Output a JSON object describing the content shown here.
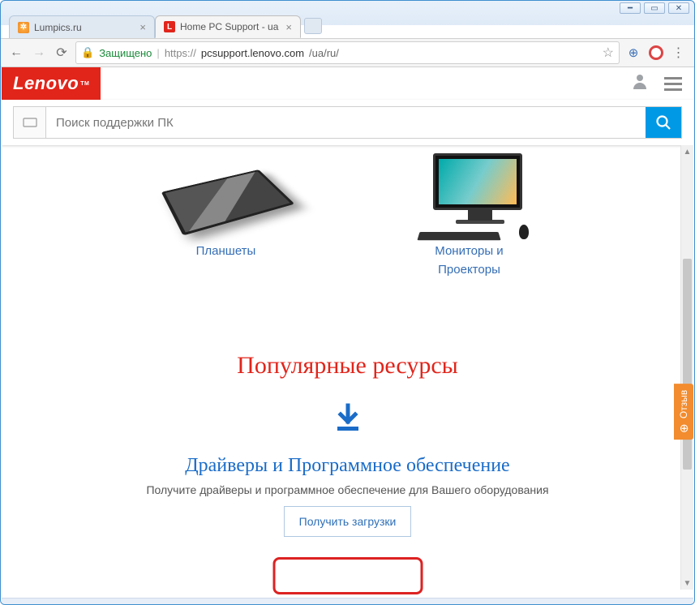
{
  "tabs": [
    {
      "title": "Lumpics.ru"
    },
    {
      "title": "Home PC Support - ua"
    }
  ],
  "toolbar": {
    "secure_label": "Защищено",
    "url_proto": "https://",
    "url_host": "pcsupport.lenovo.com",
    "url_path": "/ua/ru/"
  },
  "site": {
    "logo_text": "Lenovo",
    "logo_tm": "TM",
    "search_placeholder": "Поиск поддержки ПК"
  },
  "categories": {
    "tablets_label": "Планшеты",
    "monitors_label_1": "Мониторы и",
    "monitors_label_2": "Проекторы"
  },
  "popular": {
    "title": "Популярные ресурсы",
    "drivers_title": "Драйверы и Программное обеспечение",
    "drivers_desc": "Получите драйверы и программное обеспечение для Вашего оборудования",
    "download_button": "Получить загрузки"
  },
  "feedback": {
    "label": "Отзыв"
  }
}
